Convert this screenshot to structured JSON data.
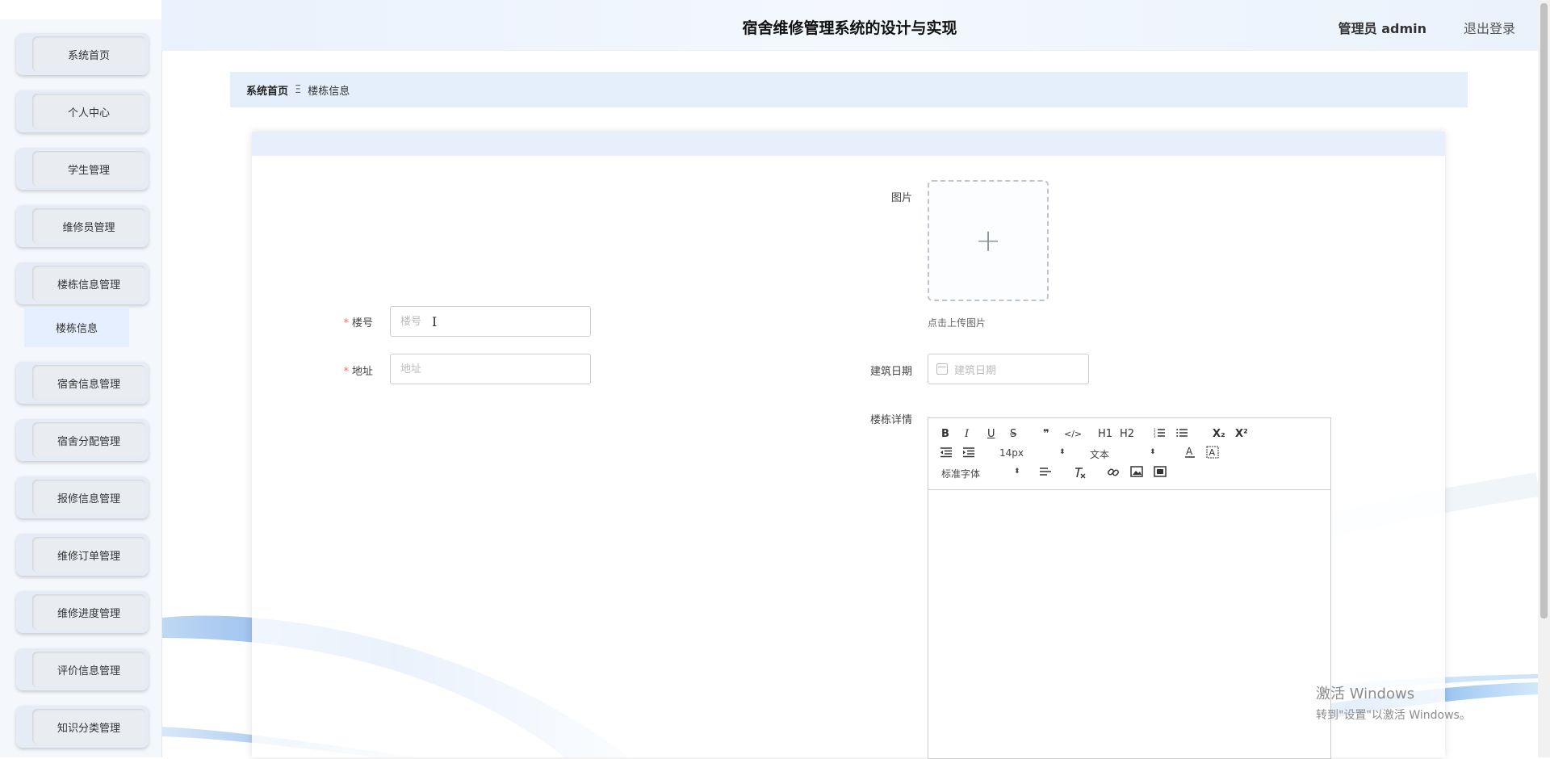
{
  "header": {
    "title": "宿舍维修管理系统的设计与实现",
    "user": "管理员 admin",
    "logout": "退出登录"
  },
  "sidebar": {
    "items": [
      {
        "label": "系统首页"
      },
      {
        "label": "个人中心"
      },
      {
        "label": "学生管理"
      },
      {
        "label": "维修员管理"
      },
      {
        "label": "楼栋信息管理"
      },
      {
        "label": "宿舍信息管理"
      },
      {
        "label": "宿舍分配管理"
      },
      {
        "label": "报修信息管理"
      },
      {
        "label": "维修订单管理"
      },
      {
        "label": "维修进度管理"
      },
      {
        "label": "评价信息管理"
      },
      {
        "label": "知识分类管理"
      }
    ],
    "active_sub": "楼栋信息"
  },
  "breadcrumb": {
    "home": "系统首页",
    "separator": "Ξ",
    "current": "楼栋信息"
  },
  "form": {
    "building_no": {
      "label": "楼号",
      "placeholder": "楼号",
      "value": ""
    },
    "address": {
      "label": "地址",
      "placeholder": "地址",
      "value": ""
    },
    "image": {
      "label": "图片",
      "hint": "点击上传图片"
    },
    "build_date": {
      "label": "建筑日期",
      "placeholder": "建筑日期"
    },
    "details": {
      "label": "楼栋详情"
    }
  },
  "editor": {
    "font_size": "14px",
    "header_picker": "文本",
    "font_family": "标准字体",
    "tools_row1": [
      "B",
      "I",
      "U",
      "S",
      "❞",
      "</>",
      "H1",
      "H2",
      "ordered-list",
      "bullet-list",
      "X₂",
      "X²"
    ]
  },
  "watermark": {
    "line1": "激活 Windows",
    "line2": "转到\"设置\"以激活 Windows。"
  },
  "colors": {
    "accent": "#e5effc",
    "required": "#f56c6c",
    "wave": "#4a8fe0"
  }
}
